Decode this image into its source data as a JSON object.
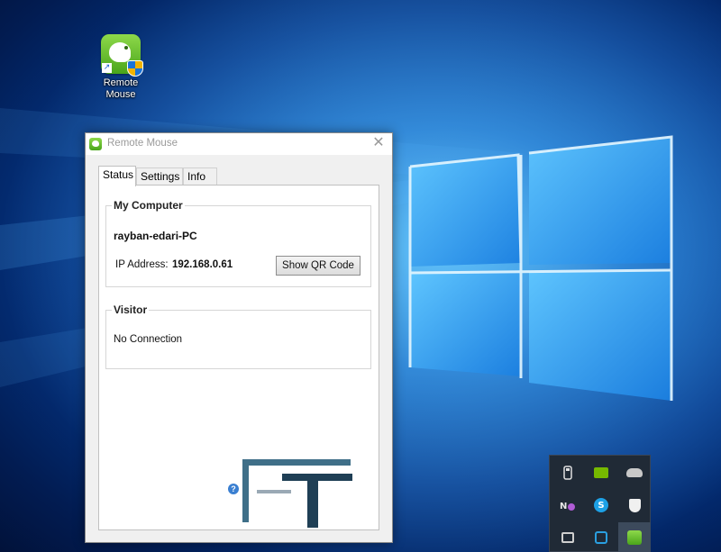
{
  "desktop": {
    "icon_label_line1": "Remote",
    "icon_label_line2": "Mouse"
  },
  "window": {
    "title": "Remote Mouse",
    "close_glyph": "✕",
    "tabs": [
      {
        "label": "Status",
        "active": true
      },
      {
        "label": "Settings",
        "active": false
      },
      {
        "label": "Info",
        "active": false
      }
    ],
    "my_computer": {
      "legend": "My Computer",
      "pc_name": "rayban-edari-PC",
      "ip_label": "IP Address:",
      "ip_value": "192.168.0.61",
      "qr_button": "Show QR Code"
    },
    "visitor": {
      "legend": "Visitor",
      "status": "No Connection"
    },
    "help_glyph": "?",
    "watermark_logo": "FaraTamir"
  },
  "tray": {
    "icons": [
      "usb-device-icon",
      "nvidia-icon",
      "onedrive-cloud-icon",
      "onenote-icon",
      "skype-icon",
      "windows-defender-icon",
      "device-icon",
      "clipboard-sync-icon",
      "remote-mouse-tray-icon"
    ]
  },
  "colors": {
    "accent_green": "#4aa51b",
    "desktop_blue": "#0a62c4",
    "tray_bg": "#202a36"
  }
}
